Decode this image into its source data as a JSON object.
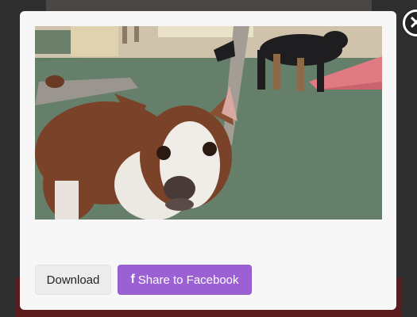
{
  "modal": {
    "download_label": "Download",
    "share_label": "Share to Facebook",
    "share_icon": "f",
    "close_glyph": "✕"
  },
  "photo": {
    "subject": "dog-photo"
  },
  "colors": {
    "share_button": "#9b61d4",
    "download_button": "#ececec",
    "modal_bg": "#f7f7f7",
    "overlay": "#2f2f2f"
  }
}
